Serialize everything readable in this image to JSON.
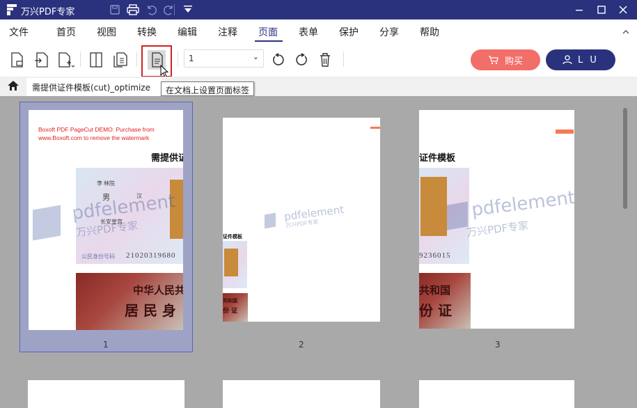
{
  "titlebar": {
    "title": "万兴PDF专家"
  },
  "menu": {
    "items": [
      {
        "label": "文件",
        "name": "menu-file"
      },
      {
        "label": "首页",
        "name": "menu-home"
      },
      {
        "label": "视图",
        "name": "menu-view"
      },
      {
        "label": "转换",
        "name": "menu-convert"
      },
      {
        "label": "编辑",
        "name": "menu-edit"
      },
      {
        "label": "注释",
        "name": "menu-comment"
      },
      {
        "label": "页面",
        "name": "menu-page",
        "active": true
      },
      {
        "label": "表单",
        "name": "menu-form"
      },
      {
        "label": "保护",
        "name": "menu-protect"
      },
      {
        "label": "分享",
        "name": "menu-share"
      },
      {
        "label": "帮助",
        "name": "menu-help"
      }
    ]
  },
  "toolbar": {
    "page_select_value": "1",
    "buy_label": "购买",
    "user_label": "L U"
  },
  "tabs": {
    "doc_tab": "需提供证件模板(cut)_optimize"
  },
  "tooltip": {
    "text": "在文档上设置页面标签"
  },
  "document": {
    "demo_line1": "Boxoft PDF PageCut DEMO: Purchase from",
    "demo_line2": "www.Boxoft.com to remove the watermark",
    "heading_p1": "需提供证",
    "heading_p3": "证件模板",
    "heading_p2_small": "证件模板",
    "watermark_brand": "pdfelement",
    "watermark_cn": "万兴PDF专家",
    "p1_name": "李 林院",
    "p1_sex_value": "男",
    "p1_ethnic": "汉",
    "p1_address": "长安皇宫",
    "p1_idnum": "21020319680",
    "p1_idlabel": "公民身份号码",
    "p3_idnum": "9236015",
    "cn_back1": "中华人民共",
    "cn_back2": "居 民 身",
    "cn_back3": "共和国",
    "cn_back4": "份 证",
    "cn_back_small1": "共和国",
    "cn_back_small2": "份 证"
  },
  "pages": [
    {
      "number": "1"
    },
    {
      "number": "2"
    },
    {
      "number": "3"
    }
  ],
  "colors": {
    "titlebar": "#2a327e",
    "accent": "#2a327e",
    "buy": "#f26e68",
    "highlight": "#d12020"
  }
}
